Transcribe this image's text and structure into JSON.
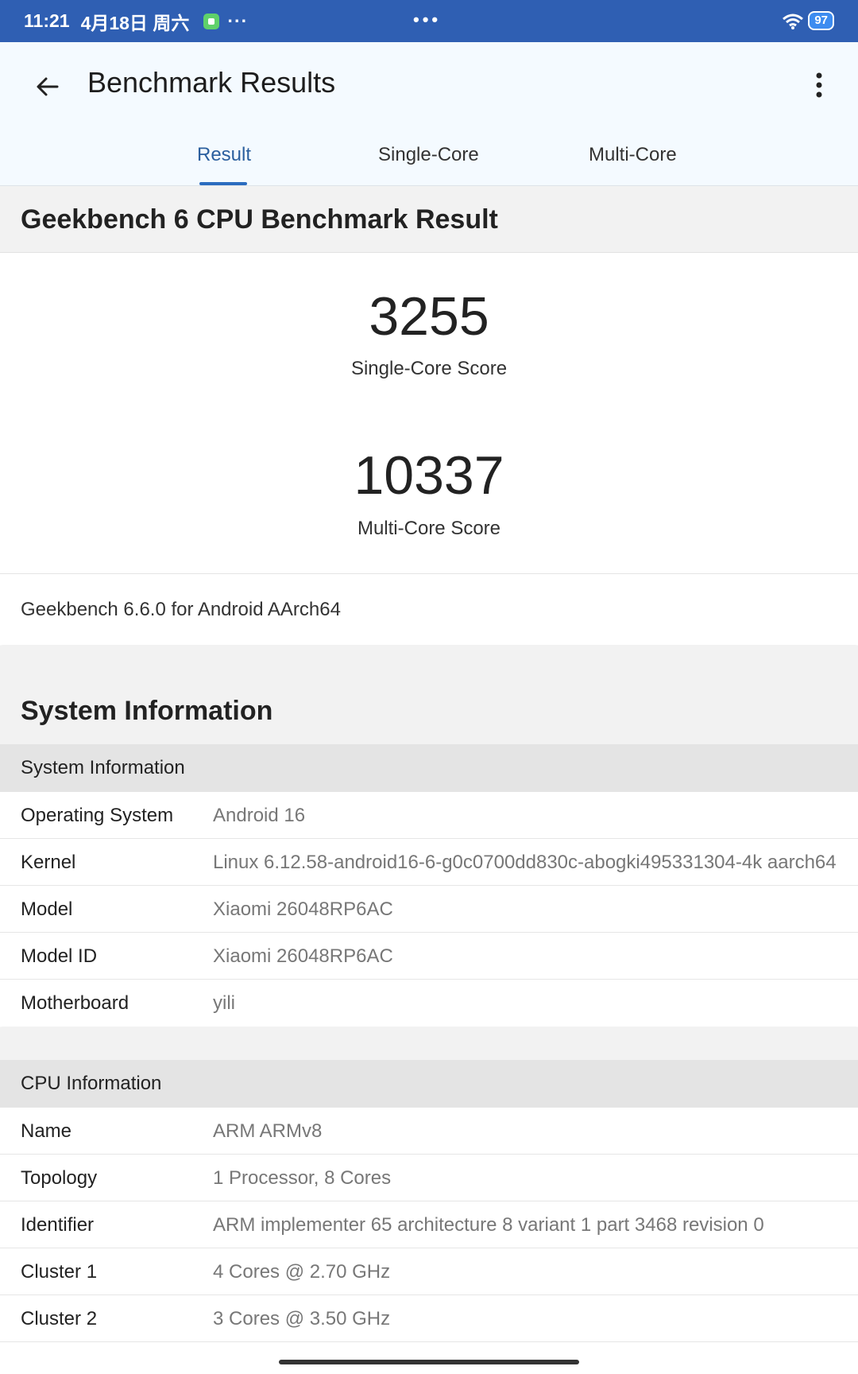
{
  "status_bar": {
    "time": "11:21",
    "date": "4月18日 周六",
    "more": "···",
    "center": "•••",
    "battery": "97"
  },
  "app_bar": {
    "title": "Benchmark Results",
    "tabs": [
      {
        "label": "Result",
        "active": true
      },
      {
        "label": "Single-Core",
        "active": false
      },
      {
        "label": "Multi-Core",
        "active": false
      }
    ]
  },
  "result": {
    "heading": "Geekbench 6 CPU Benchmark Result",
    "single_core_score": "3255",
    "single_core_label": "Single-Core Score",
    "multi_core_score": "10337",
    "multi_core_label": "Multi-Core Score",
    "version": "Geekbench 6.6.0 for Android AArch64"
  },
  "system_information": {
    "heading": "System Information",
    "subheading": "System Information",
    "rows": [
      {
        "key": "Operating System",
        "value": "Android 16"
      },
      {
        "key": "Kernel",
        "value": "Linux 6.12.58-android16-6-g0c0700dd830c-abogki495331304-4k aarch64"
      },
      {
        "key": "Model",
        "value": "Xiaomi 26048RP6AC"
      },
      {
        "key": "Model ID",
        "value": "Xiaomi 26048RP6AC"
      },
      {
        "key": "Motherboard",
        "value": "yili"
      }
    ]
  },
  "cpu_information": {
    "subheading": "CPU Information",
    "rows": [
      {
        "key": "Name",
        "value": "ARM ARMv8"
      },
      {
        "key": "Topology",
        "value": "1 Processor, 8 Cores"
      },
      {
        "key": "Identifier",
        "value": "ARM implementer 65 architecture 8 variant 1 part 3468 revision 0"
      },
      {
        "key": "Cluster 1",
        "value": "4 Cores @ 2.70 GHz"
      },
      {
        "key": "Cluster 2",
        "value": "3 Cores @ 3.50 GHz"
      }
    ]
  },
  "colors": {
    "status_bar": "#2f5fb3",
    "accent": "#2b6cbf",
    "app_bar_bg": "#f4faff"
  },
  "icons": [
    "back-arrow-icon",
    "overflow-menu-icon",
    "wifi-icon",
    "battery-icon"
  ]
}
